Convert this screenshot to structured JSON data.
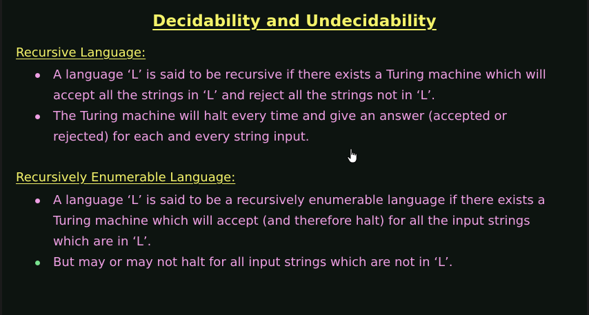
{
  "slide": {
    "title": "Decidability and Undecidability",
    "sections": [
      {
        "heading": "Recursive Language:",
        "bullets": [
          "A language ‘L’ is said to be recursive if there exists a Turing machine which will accept all the strings in ‘L’ and reject all the strings not in ‘L’.",
          "The Turing machine will halt every time and give an answer (accepted or rejected) for each and every string input."
        ]
      },
      {
        "heading": "Recursively Enumerable Language:",
        "bullets": [
          "A language ‘L’ is said to be a recursively enumerable language if there exists a Turing machine which will accept (and therefore halt) for all the input strings which are in ‘L’.",
          "But may or may not halt for all input strings which are not in ‘L’."
        ]
      }
    ]
  },
  "colors": {
    "background": "#0d1410",
    "title": "#f4f36a",
    "heading": "#f4f36a",
    "body_text": "#ee9fe3",
    "bullet_highlight": "#79e38f"
  },
  "icons": {
    "cursor": "hand-pointer-icon"
  }
}
